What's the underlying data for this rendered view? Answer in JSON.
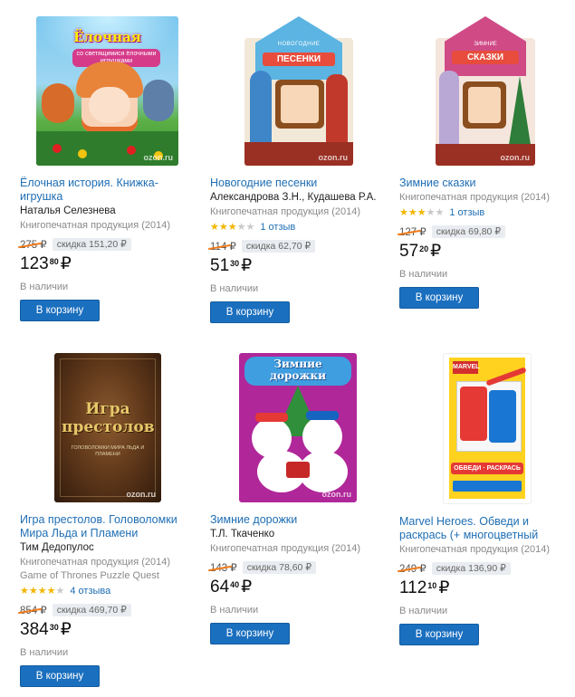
{
  "products": [
    {
      "title": "Ёлочная история. Книжка-игрушка",
      "author": "Наталья Селезнева",
      "publisher": "Книгопечатная продукция (2014)",
      "old_price": "275 ₽",
      "discount": "скидка 151,20 ₽",
      "price_rub": "123",
      "price_kop": "80",
      "currency": "₽",
      "availability": "В наличии",
      "button": "В корзину",
      "cover_text": "Ёлочная история",
      "cover_subtext": "со светящимися ёлочными игрушками",
      "watermark": "ozon.ru"
    },
    {
      "title": "Новогодние песенки",
      "author": "Александрова З.Н., Кудашева Р.А.",
      "publisher": "Книгопечатная продукция (2014)",
      "rating": 3,
      "reviews": "1 отзыв",
      "old_price": "114 ₽",
      "discount": "скидка 62,70 ₽",
      "price_rub": "51",
      "price_kop": "30",
      "currency": "₽",
      "availability": "В наличии",
      "button": "В корзину",
      "cover_text": "ПЕСЕНКИ",
      "cover_subtext": "НОВОГОДНИЕ",
      "watermark": "ozon.ru"
    },
    {
      "title": "Зимние сказки",
      "publisher": "Книгопечатная продукция (2014)",
      "rating": 3,
      "reviews": "1 отзыв",
      "old_price": "127 ₽",
      "discount": "скидка 69,80 ₽",
      "price_rub": "57",
      "price_kop": "20",
      "currency": "₽",
      "availability": "В наличии",
      "button": "В корзину",
      "cover_text": "СКАЗКИ",
      "cover_subtext": "ЗИМНИЕ",
      "watermark": "ozon.ru"
    },
    {
      "title": "Игра престолов. Головоломки Мира Льда и Пламени",
      "author": "Тим Дедопулос",
      "publisher": "Книгопечатная продукция (2014)",
      "series": "Game of Thrones Puzzle Quest",
      "rating": 4,
      "reviews": "4 отзыва",
      "old_price": "854 ₽",
      "discount": "скидка 469,70 ₽",
      "price_rub": "384",
      "price_kop": "30",
      "currency": "₽",
      "availability": "В наличии",
      "button": "В корзину",
      "cover_text": "Игра престолов",
      "cover_subtext": "ГОЛОВОЛОМКИ МИРА ЛЬДА И ПЛАМЕНИ",
      "watermark": "ozon.ru"
    },
    {
      "title": "Зимние дорожки",
      "author": "Т.Л. Ткаченко",
      "publisher": "Книгопечатная продукция (2014)",
      "old_price": "143 ₽",
      "discount": "скидка 78,60 ₽",
      "price_rub": "64",
      "price_kop": "40",
      "currency": "₽",
      "availability": "В наличии",
      "button": "В корзину",
      "cover_text": "Зимние дорожки",
      "watermark": "ozon.ru"
    },
    {
      "title": "Marvel Heroes. Обведи и раскрась (+ многоцветный",
      "publisher": "Книгопечатная продукция (2014)",
      "old_price": "249 ₽",
      "discount": "скидка 136,90 ₽",
      "price_rub": "112",
      "price_kop": "10",
      "currency": "₽",
      "availability": "В наличии",
      "button": "В корзину",
      "cover_text": "ОБВЕДИ · РАСКРАСЬ",
      "cover_subtext": "MARVEL",
      "watermark": "ozon.ru"
    }
  ],
  "colors": {
    "link": "#1e6eb4",
    "button": "#1a6fbf",
    "strike": "#f07b1a",
    "star": "#f2b600"
  }
}
